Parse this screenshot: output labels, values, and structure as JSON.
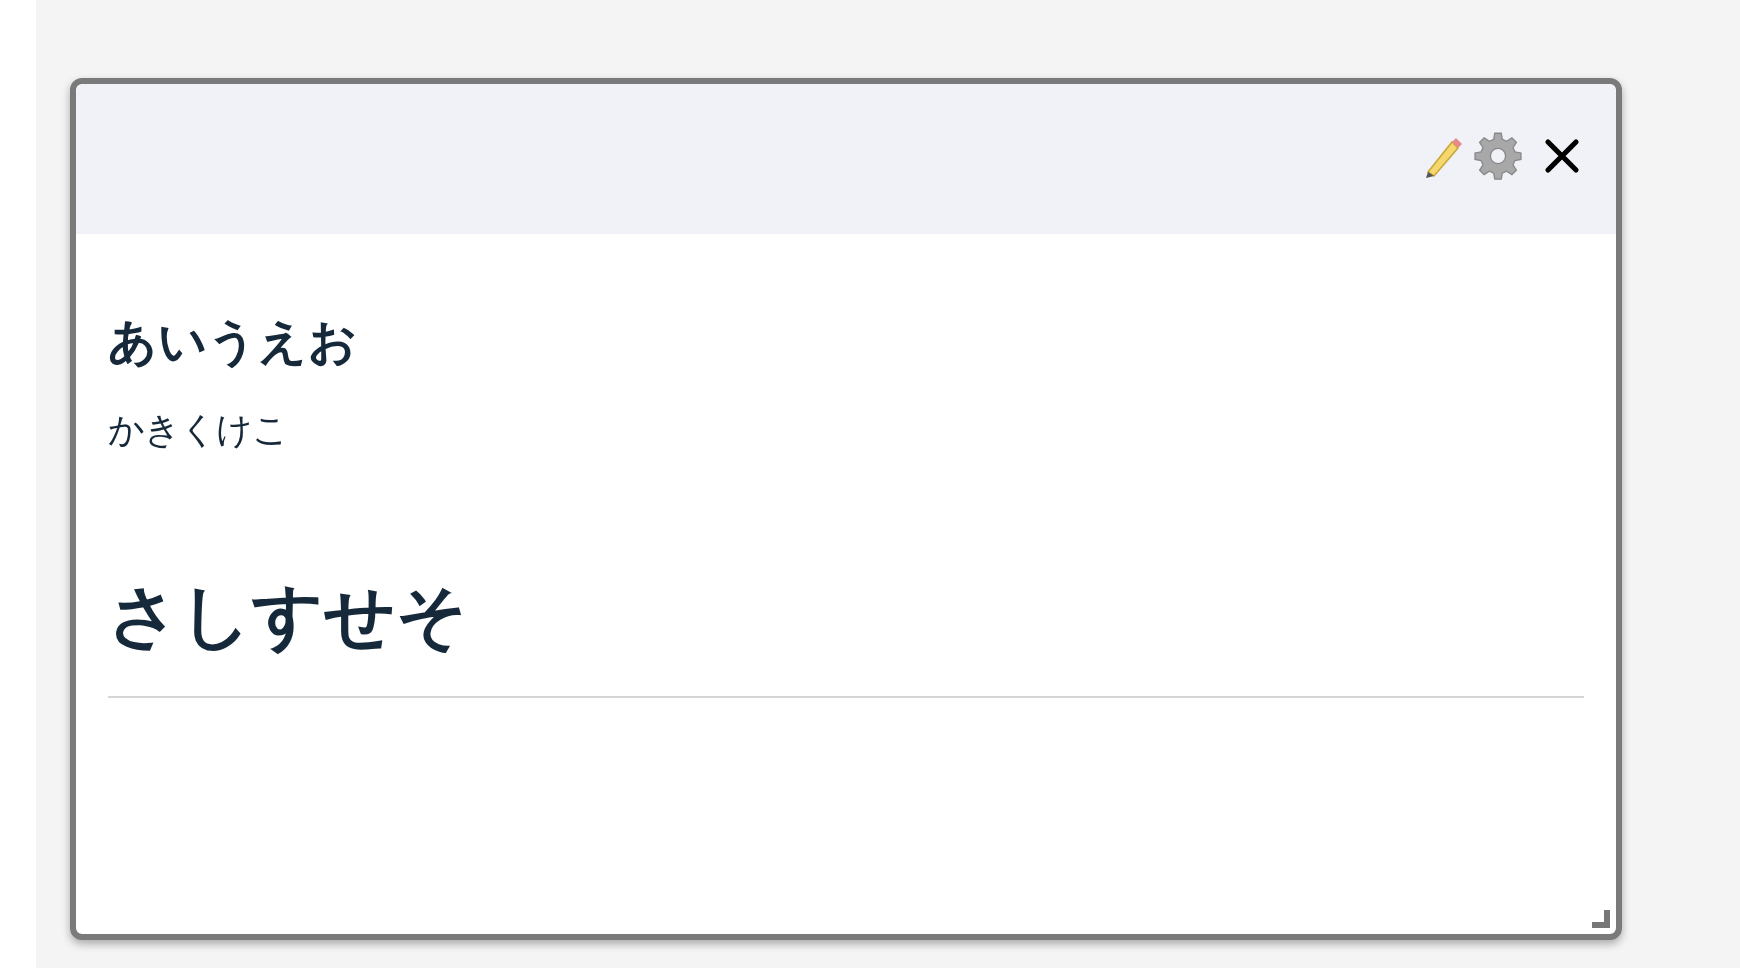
{
  "panel": {
    "heading": "あいうえお",
    "paragraph": "かきくけこ",
    "section_heading": "さしすせそ"
  }
}
